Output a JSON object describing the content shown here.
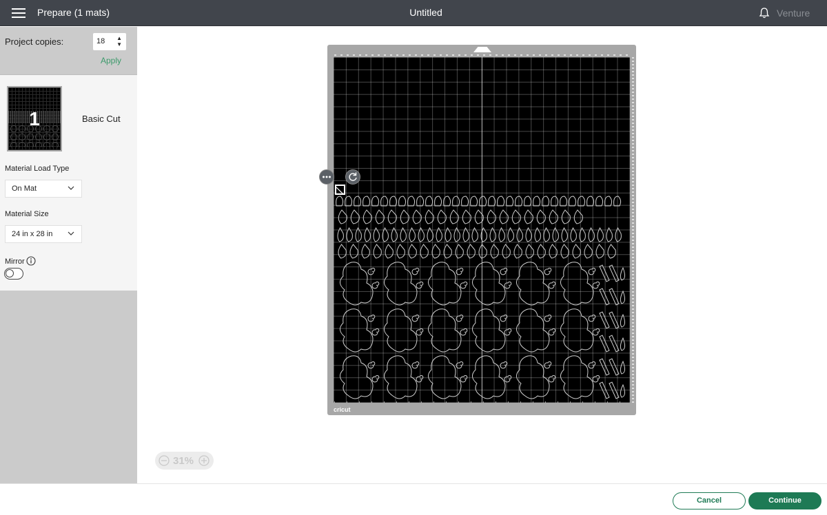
{
  "header": {
    "menu_icon": "hamburger-icon",
    "prepare_title": "Prepare (1 mats)",
    "document_title": "Untitled",
    "notification_icon": "bell-icon",
    "user_name": "Venture"
  },
  "sidebar": {
    "project_copies_label": "Project copies:",
    "project_copies_value": "18",
    "apply_label": "Apply",
    "mats": [
      {
        "number": "1",
        "type": "Basic Cut"
      }
    ],
    "material_load_type_label": "Material Load Type",
    "material_load_type_value": "On Mat",
    "material_size_label": "Material Size",
    "material_size_value": "24 in x 28 in",
    "mirror_label": "Mirror",
    "mirror_on": false
  },
  "canvas": {
    "mat_brand": "cricut",
    "zoom_level": "31%"
  },
  "footer": {
    "cancel_label": "Cancel",
    "continue_label": "Continue"
  },
  "colors": {
    "accent": "#1e7a55",
    "apply": "#3c9a6b",
    "topbar": "#41454c",
    "mat_background": "#000000",
    "mat_frame": "#a7a7a7"
  }
}
